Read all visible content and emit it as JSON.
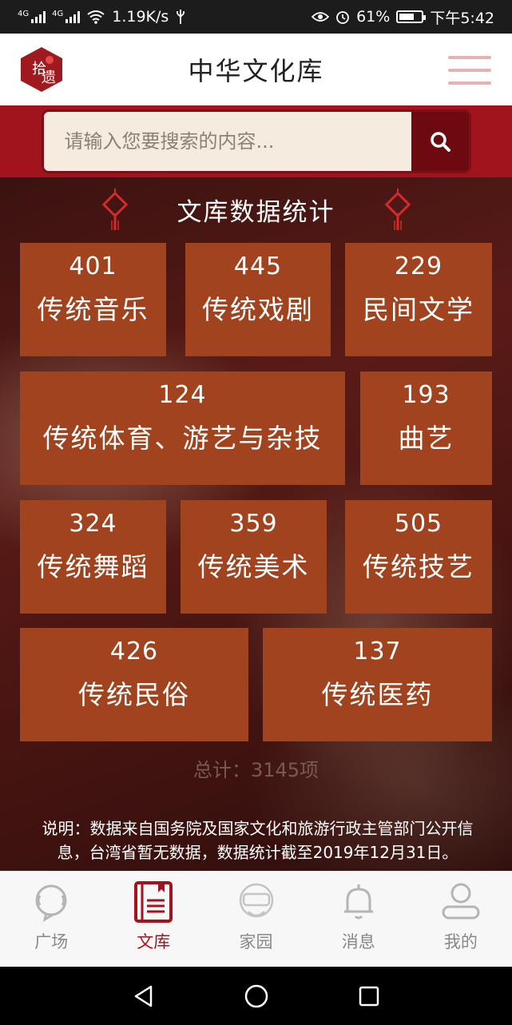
{
  "status_bar": {
    "net_left": "4G",
    "net_right": "4G",
    "speed": "1.19K/s",
    "battery": "61%",
    "time": "下午5:42"
  },
  "header": {
    "title": "中华文化库",
    "logo_text": "拾遗"
  },
  "search": {
    "placeholder": "请输入您要搜索的内容..."
  },
  "stats": {
    "title": "文库数据统计",
    "tiles": [
      {
        "count": "401",
        "label": "传统音乐"
      },
      {
        "count": "445",
        "label": "传统戏剧"
      },
      {
        "count": "229",
        "label": "民间文学"
      },
      {
        "count": "124",
        "label": "传统体育、游艺与杂技"
      },
      {
        "count": "193",
        "label": "曲艺"
      },
      {
        "count": "324",
        "label": "传统舞蹈"
      },
      {
        "count": "359",
        "label": "传统美术"
      },
      {
        "count": "505",
        "label": "传统技艺"
      },
      {
        "count": "426",
        "label": "传统民俗"
      },
      {
        "count": "137",
        "label": "传统医药"
      }
    ],
    "total": "总计：3145项",
    "note": "说明：数据来自国务院及国家文化和旅游行政主管部门公开信息，台湾省暂无数据，数据统计截至2019年12月31日。"
  },
  "tabbar": {
    "items": [
      {
        "label": "广场",
        "icon": "chat-bubble-icon"
      },
      {
        "label": "文库",
        "icon": "library-book-icon"
      },
      {
        "label": "家园",
        "icon": "vr-headset-icon"
      },
      {
        "label": "消息",
        "icon": "bell-icon"
      },
      {
        "label": "我的",
        "icon": "user-icon"
      }
    ],
    "active_index": 1
  },
  "colors": {
    "brand_red": "#a1131d",
    "tile_bg": "#a0431e",
    "search_btn": "#6c0a10"
  }
}
